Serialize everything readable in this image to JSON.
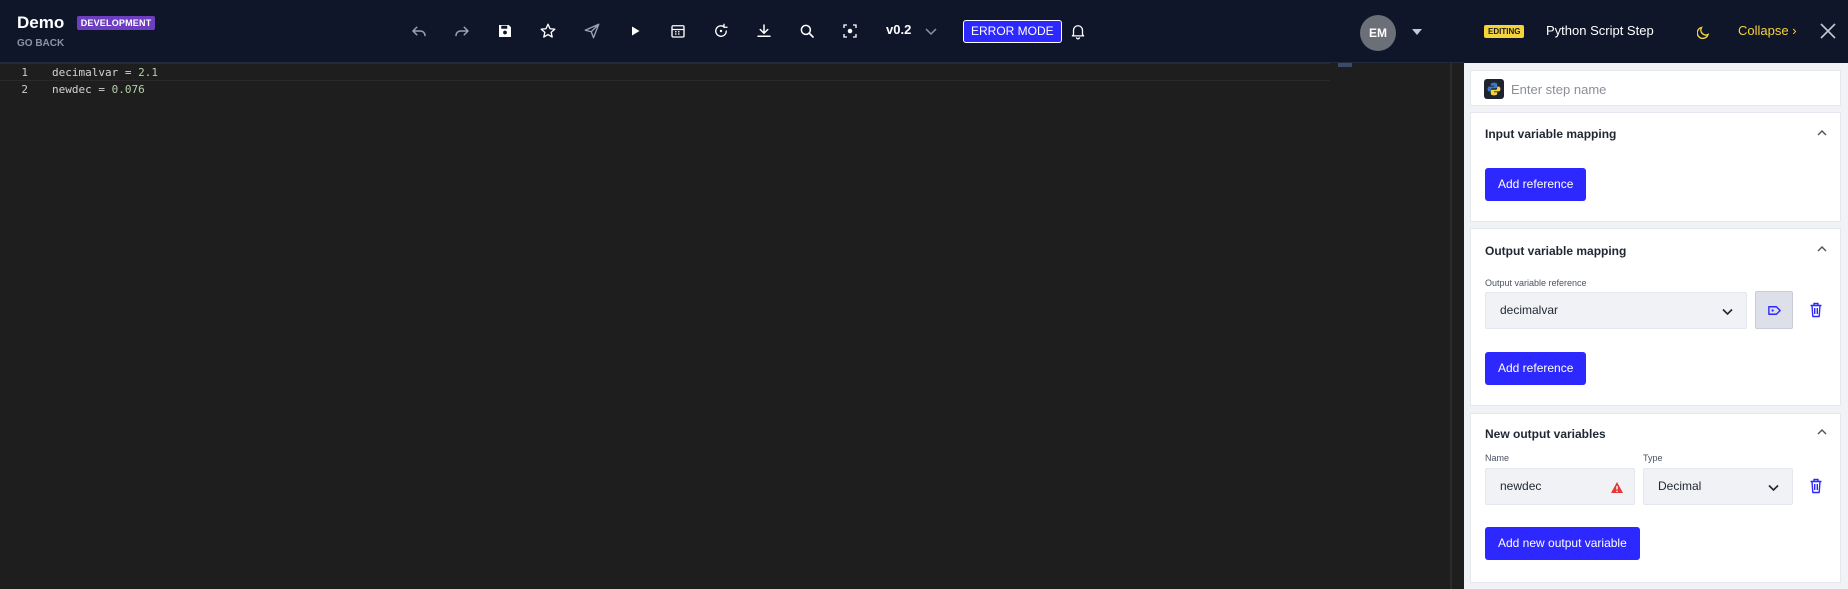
{
  "project": {
    "name": "Demo",
    "environment": "DEVELOPMENT",
    "go_back": "GO BACK"
  },
  "toolbar": {
    "icons": [
      "undo-icon",
      "redo-icon",
      "save-icon",
      "star-icon",
      "send-icon",
      "play-icon",
      "calendar-icon",
      "refresh-icon",
      "download-icon",
      "search-icon",
      "focus-icon",
      "bell-icon"
    ],
    "version": "v0.2",
    "error_mode": "ERROR MODE"
  },
  "user": {
    "initials": "EM"
  },
  "editor": {
    "lines": [
      {
        "number": "1",
        "var": "decimalvar",
        "op": " = ",
        "value": "2.1"
      },
      {
        "number": "2",
        "var": "newdec",
        "op": " = ",
        "value": "0.076"
      }
    ]
  },
  "panel": {
    "badge": "EDITING",
    "title": "Python Script Step",
    "collapse": "Collapse",
    "step_name_placeholder": "Enter step name",
    "input_mapping": {
      "title": "Input variable mapping",
      "add_label": "Add reference"
    },
    "output_mapping": {
      "title": "Output variable mapping",
      "field_label": "Output variable reference",
      "selected": "decimalvar",
      "add_label": "Add reference"
    },
    "new_outputs": {
      "title": "New output variables",
      "name_label": "Name",
      "type_label": "Type",
      "name_value": "newdec",
      "type_value": "Decimal",
      "add_label": "Add new output variable"
    }
  },
  "colors": {
    "accent": "#2d28ff",
    "header_bg": "#0f1629",
    "badge_purple": "#6d3fc0",
    "badge_yellow": "#f5d33a",
    "warning": "#e53935"
  }
}
